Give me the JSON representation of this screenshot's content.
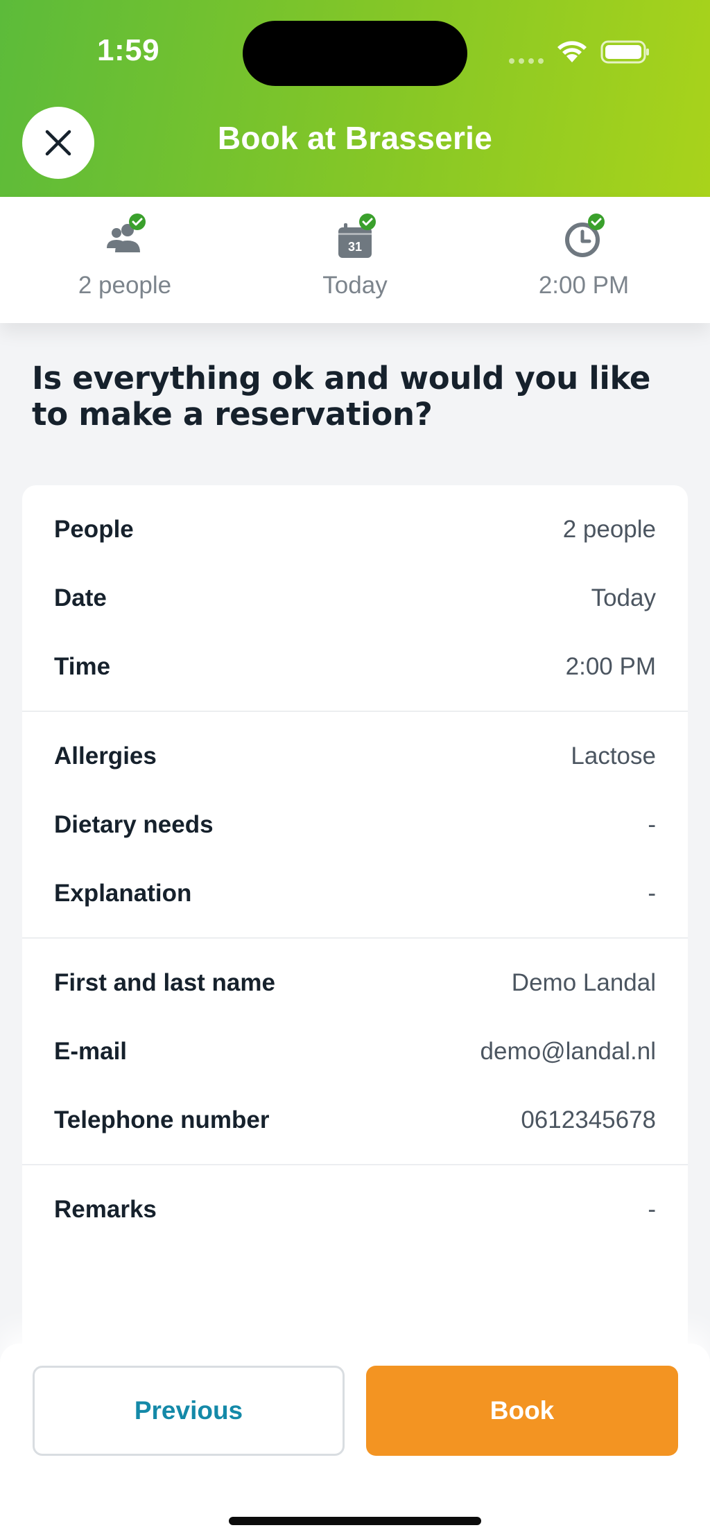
{
  "status_bar": {
    "time": "1:59"
  },
  "header": {
    "title": "Book at Brasserie",
    "close_icon": "close-icon"
  },
  "colors": {
    "header_gradient_start": "#5cbb3a",
    "header_gradient_end": "#a9d31b",
    "check_green": "#3aa02c",
    "icon_gray": "#6f7880",
    "book_orange": "#f39422",
    "previous_blue": "#1489a8"
  },
  "steps": [
    {
      "icon": "people-icon",
      "label": "2 people",
      "completed": true
    },
    {
      "icon": "calendar-icon",
      "label": "Today",
      "completed": true,
      "calendar_day": "31"
    },
    {
      "icon": "clock-icon",
      "label": "2:00 PM",
      "completed": true
    }
  ],
  "question": "Is everything ok and would you like to make a reservation?",
  "summary": {
    "sections": [
      {
        "rows": [
          {
            "key": "People",
            "value": "2 people"
          },
          {
            "key": "Date",
            "value": "Today"
          },
          {
            "key": "Time",
            "value": "2:00 PM"
          }
        ]
      },
      {
        "rows": [
          {
            "key": "Allergies",
            "value": "Lactose"
          },
          {
            "key": "Dietary needs",
            "value": "-"
          },
          {
            "key": "Explanation",
            "value": "-"
          }
        ]
      },
      {
        "rows": [
          {
            "key": "First and last name",
            "value": "Demo Landal"
          },
          {
            "key": "E-mail",
            "value": "demo@landal.nl"
          },
          {
            "key": "Telephone number",
            "value": "0612345678"
          }
        ]
      },
      {
        "rows": [
          {
            "key": "Remarks",
            "value": "-"
          }
        ]
      }
    ]
  },
  "actions": {
    "previous_label": "Previous",
    "book_label": "Book"
  }
}
